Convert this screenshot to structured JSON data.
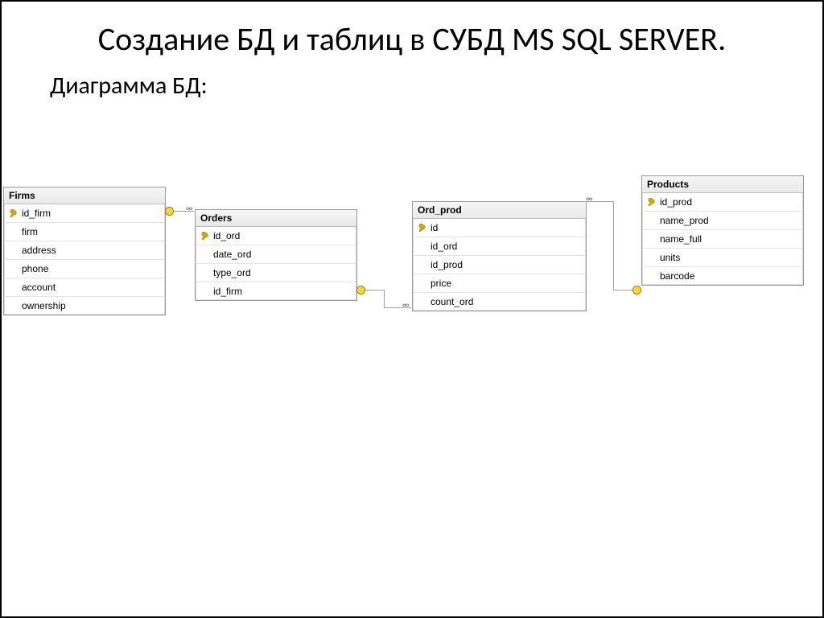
{
  "title": "Создание БД и таблиц в СУБД MS SQL SERVER.",
  "subtitle": "Диаграмма БД:",
  "tables": {
    "firms": {
      "header": "Firms",
      "cols": [
        {
          "name": "id_firm",
          "pk": true
        },
        {
          "name": "firm",
          "pk": false
        },
        {
          "name": "address",
          "pk": false
        },
        {
          "name": "phone",
          "pk": false
        },
        {
          "name": "account",
          "pk": false
        },
        {
          "name": "ownership",
          "pk": false
        }
      ]
    },
    "orders": {
      "header": "Orders",
      "cols": [
        {
          "name": "id_ord",
          "pk": true
        },
        {
          "name": "date_ord",
          "pk": false
        },
        {
          "name": "type_ord",
          "pk": false
        },
        {
          "name": "id_firm",
          "pk": false
        }
      ]
    },
    "ord_prod": {
      "header": "Ord_prod",
      "cols": [
        {
          "name": "id",
          "pk": true
        },
        {
          "name": "id_ord",
          "pk": false
        },
        {
          "name": "id_prod",
          "pk": false
        },
        {
          "name": "price",
          "pk": false
        },
        {
          "name": "count_ord",
          "pk": false
        }
      ]
    },
    "products": {
      "header": "Products",
      "cols": [
        {
          "name": "id_prod",
          "pk": true
        },
        {
          "name": "name_prod",
          "pk": false
        },
        {
          "name": "name_full",
          "pk": false
        },
        {
          "name": "units",
          "pk": false
        },
        {
          "name": "barcode",
          "pk": false
        }
      ]
    }
  },
  "relationships": [
    {
      "from": "Firms.id_firm",
      "to": "Orders.id_firm"
    },
    {
      "from": "Orders.id_ord",
      "to": "Ord_prod.id_ord"
    },
    {
      "from": "Products.id_prod",
      "to": "Ord_prod.id_prod"
    }
  ]
}
